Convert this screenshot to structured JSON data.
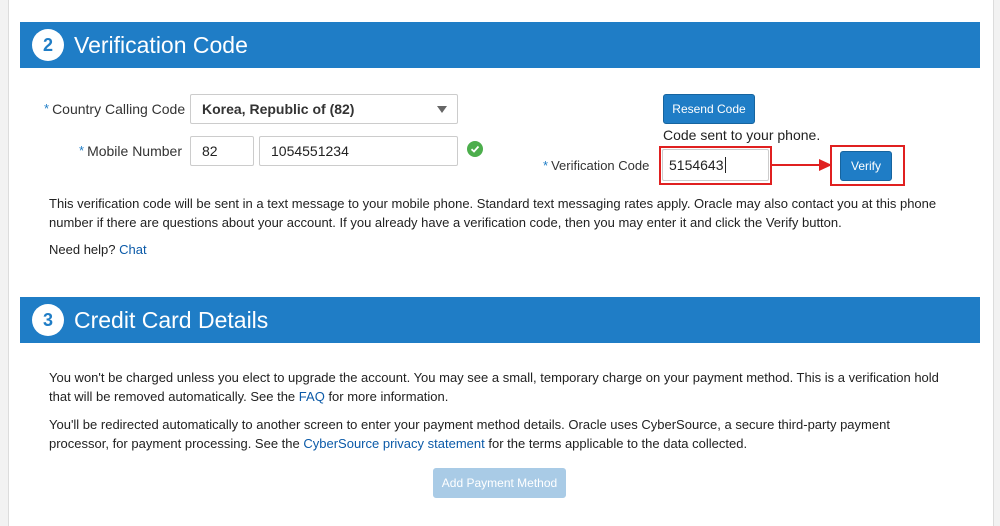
{
  "section2": {
    "step": "2",
    "title": "Verification Code",
    "country_label": "Country Calling Code",
    "country_value": "Korea, Republic of (82)",
    "mobile_label": "Mobile Number",
    "mobile_prefix": "82",
    "mobile_number": "1054551234",
    "resend_button": "Resend Code",
    "code_sent_text": "Code sent to your phone.",
    "verification_label": "Verification Code",
    "verification_value": "5154643",
    "verify_button": "Verify",
    "info_text": "This verification code will be sent in a text message to your mobile phone. Standard text messaging rates apply. Oracle may also contact you at this phone number if there are questions about your account. If you already have a verification code, then you may enter it and click the Verify button.",
    "help_text": "Need help?",
    "help_link": "Chat"
  },
  "section3": {
    "step": "3",
    "title": "Credit Card Details",
    "para1_before": "You won't be charged unless you elect to upgrade the account. You may see a small, temporary charge on your payment method. This is a verification hold that will be removed automatically. See the",
    "para1_link": "FAQ",
    "para1_after": "for more information.",
    "para2_before": "You'll be redirected automatically to another screen to enter your payment method details. Oracle uses CyberSource, a secure third-party payment processor, for payment processing. See the",
    "para2_link": "CyberSource privacy statement",
    "para2_after": "for the terms applicable to the data collected.",
    "add_button": "Add Payment Method"
  },
  "required_marker": "*",
  "colors": {
    "header_blue": "#1f7dc6",
    "link_blue": "#0b5aa8",
    "annotation_red": "#e02020",
    "success_green": "#4cae4c",
    "disabled_button": "#a9cbe6"
  },
  "icons": {
    "check": "check-circle-icon",
    "dropdown": "chevron-down-icon",
    "arrow": "arrow-right-icon"
  }
}
